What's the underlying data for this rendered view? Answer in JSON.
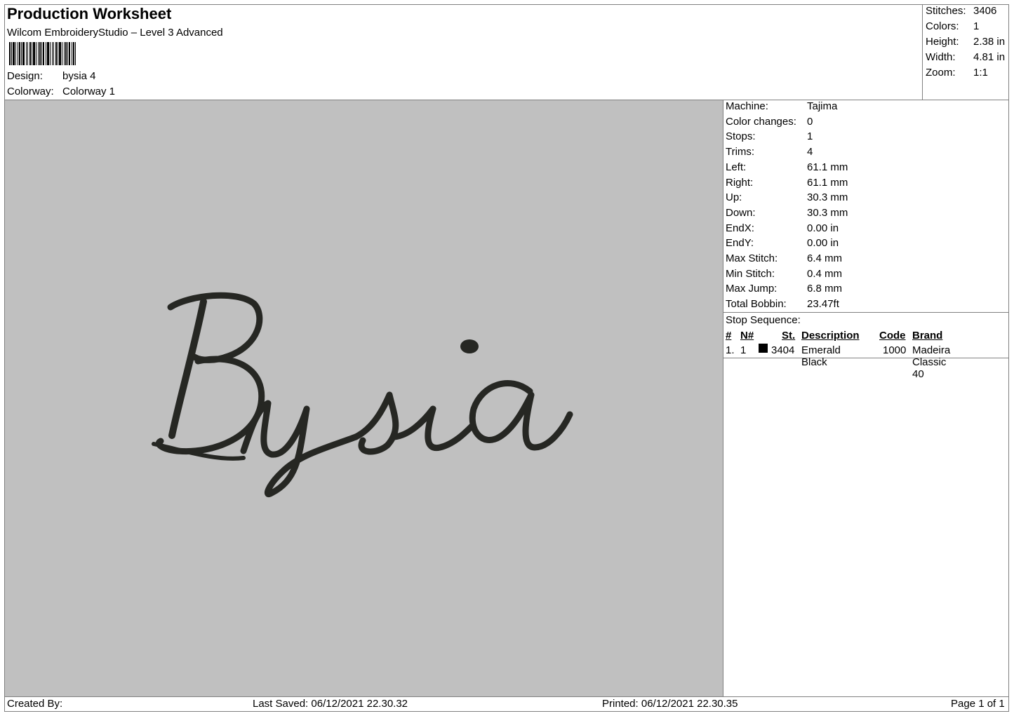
{
  "header": {
    "title": "Production Worksheet",
    "software": "Wilcom EmbroideryStudio – Level 3 Advanced",
    "design_label": "Design:",
    "design_value": "bysia 4",
    "colorway_label": "Colorway:",
    "colorway_value": "Colorway 1"
  },
  "stats": [
    {
      "label": "Stitches:",
      "value": "3406"
    },
    {
      "label": "Colors:",
      "value": "1"
    },
    {
      "label": "Height:",
      "value": "2.38 in"
    },
    {
      "label": "Width:",
      "value": "4.81 in"
    },
    {
      "label": "Zoom:",
      "value": "1:1"
    }
  ],
  "design": {
    "text": "Bysia",
    "thread_color": "#262723",
    "background_color": "#c0c0c0"
  },
  "machine_info": [
    {
      "label": "Machine:",
      "value": "Tajima"
    },
    {
      "label": "Color changes:",
      "value": "0"
    },
    {
      "label": "Stops:",
      "value": "1"
    },
    {
      "label": "Trims:",
      "value": "4"
    },
    {
      "label": "Left:",
      "value": "61.1 mm"
    },
    {
      "label": "Right:",
      "value": "61.1 mm"
    },
    {
      "label": "Up:",
      "value": "30.3 mm"
    },
    {
      "label": "Down:",
      "value": "30.3 mm"
    },
    {
      "label": "EndX:",
      "value": "0.00 in"
    },
    {
      "label": "EndY:",
      "value": "0.00 in"
    },
    {
      "label": "Max Stitch:",
      "value": "6.4 mm"
    },
    {
      "label": "Min Stitch:",
      "value": "0.4 mm"
    },
    {
      "label": "Max Jump:",
      "value": "6.8 mm"
    },
    {
      "label": "Total Bobbin:",
      "value": "23.47ft"
    }
  ],
  "stop_sequence": {
    "title": "Stop Sequence:",
    "columns": {
      "num": "#",
      "n": "N#",
      "st": "St.",
      "description": "Description",
      "code": "Code",
      "brand": "Brand"
    },
    "rows": [
      {
        "num": "1.",
        "n": "1",
        "swatch": "#000000",
        "st": "3404",
        "description": "Emerald Black",
        "code": "1000",
        "brand": "Madeira Classic 40"
      }
    ]
  },
  "footer": {
    "created_by": "Created By:",
    "last_saved": "Last Saved: 06/12/2021 22.30.32",
    "printed": "Printed: 06/12/2021 22.30.35",
    "page": "Page 1 of 1"
  }
}
